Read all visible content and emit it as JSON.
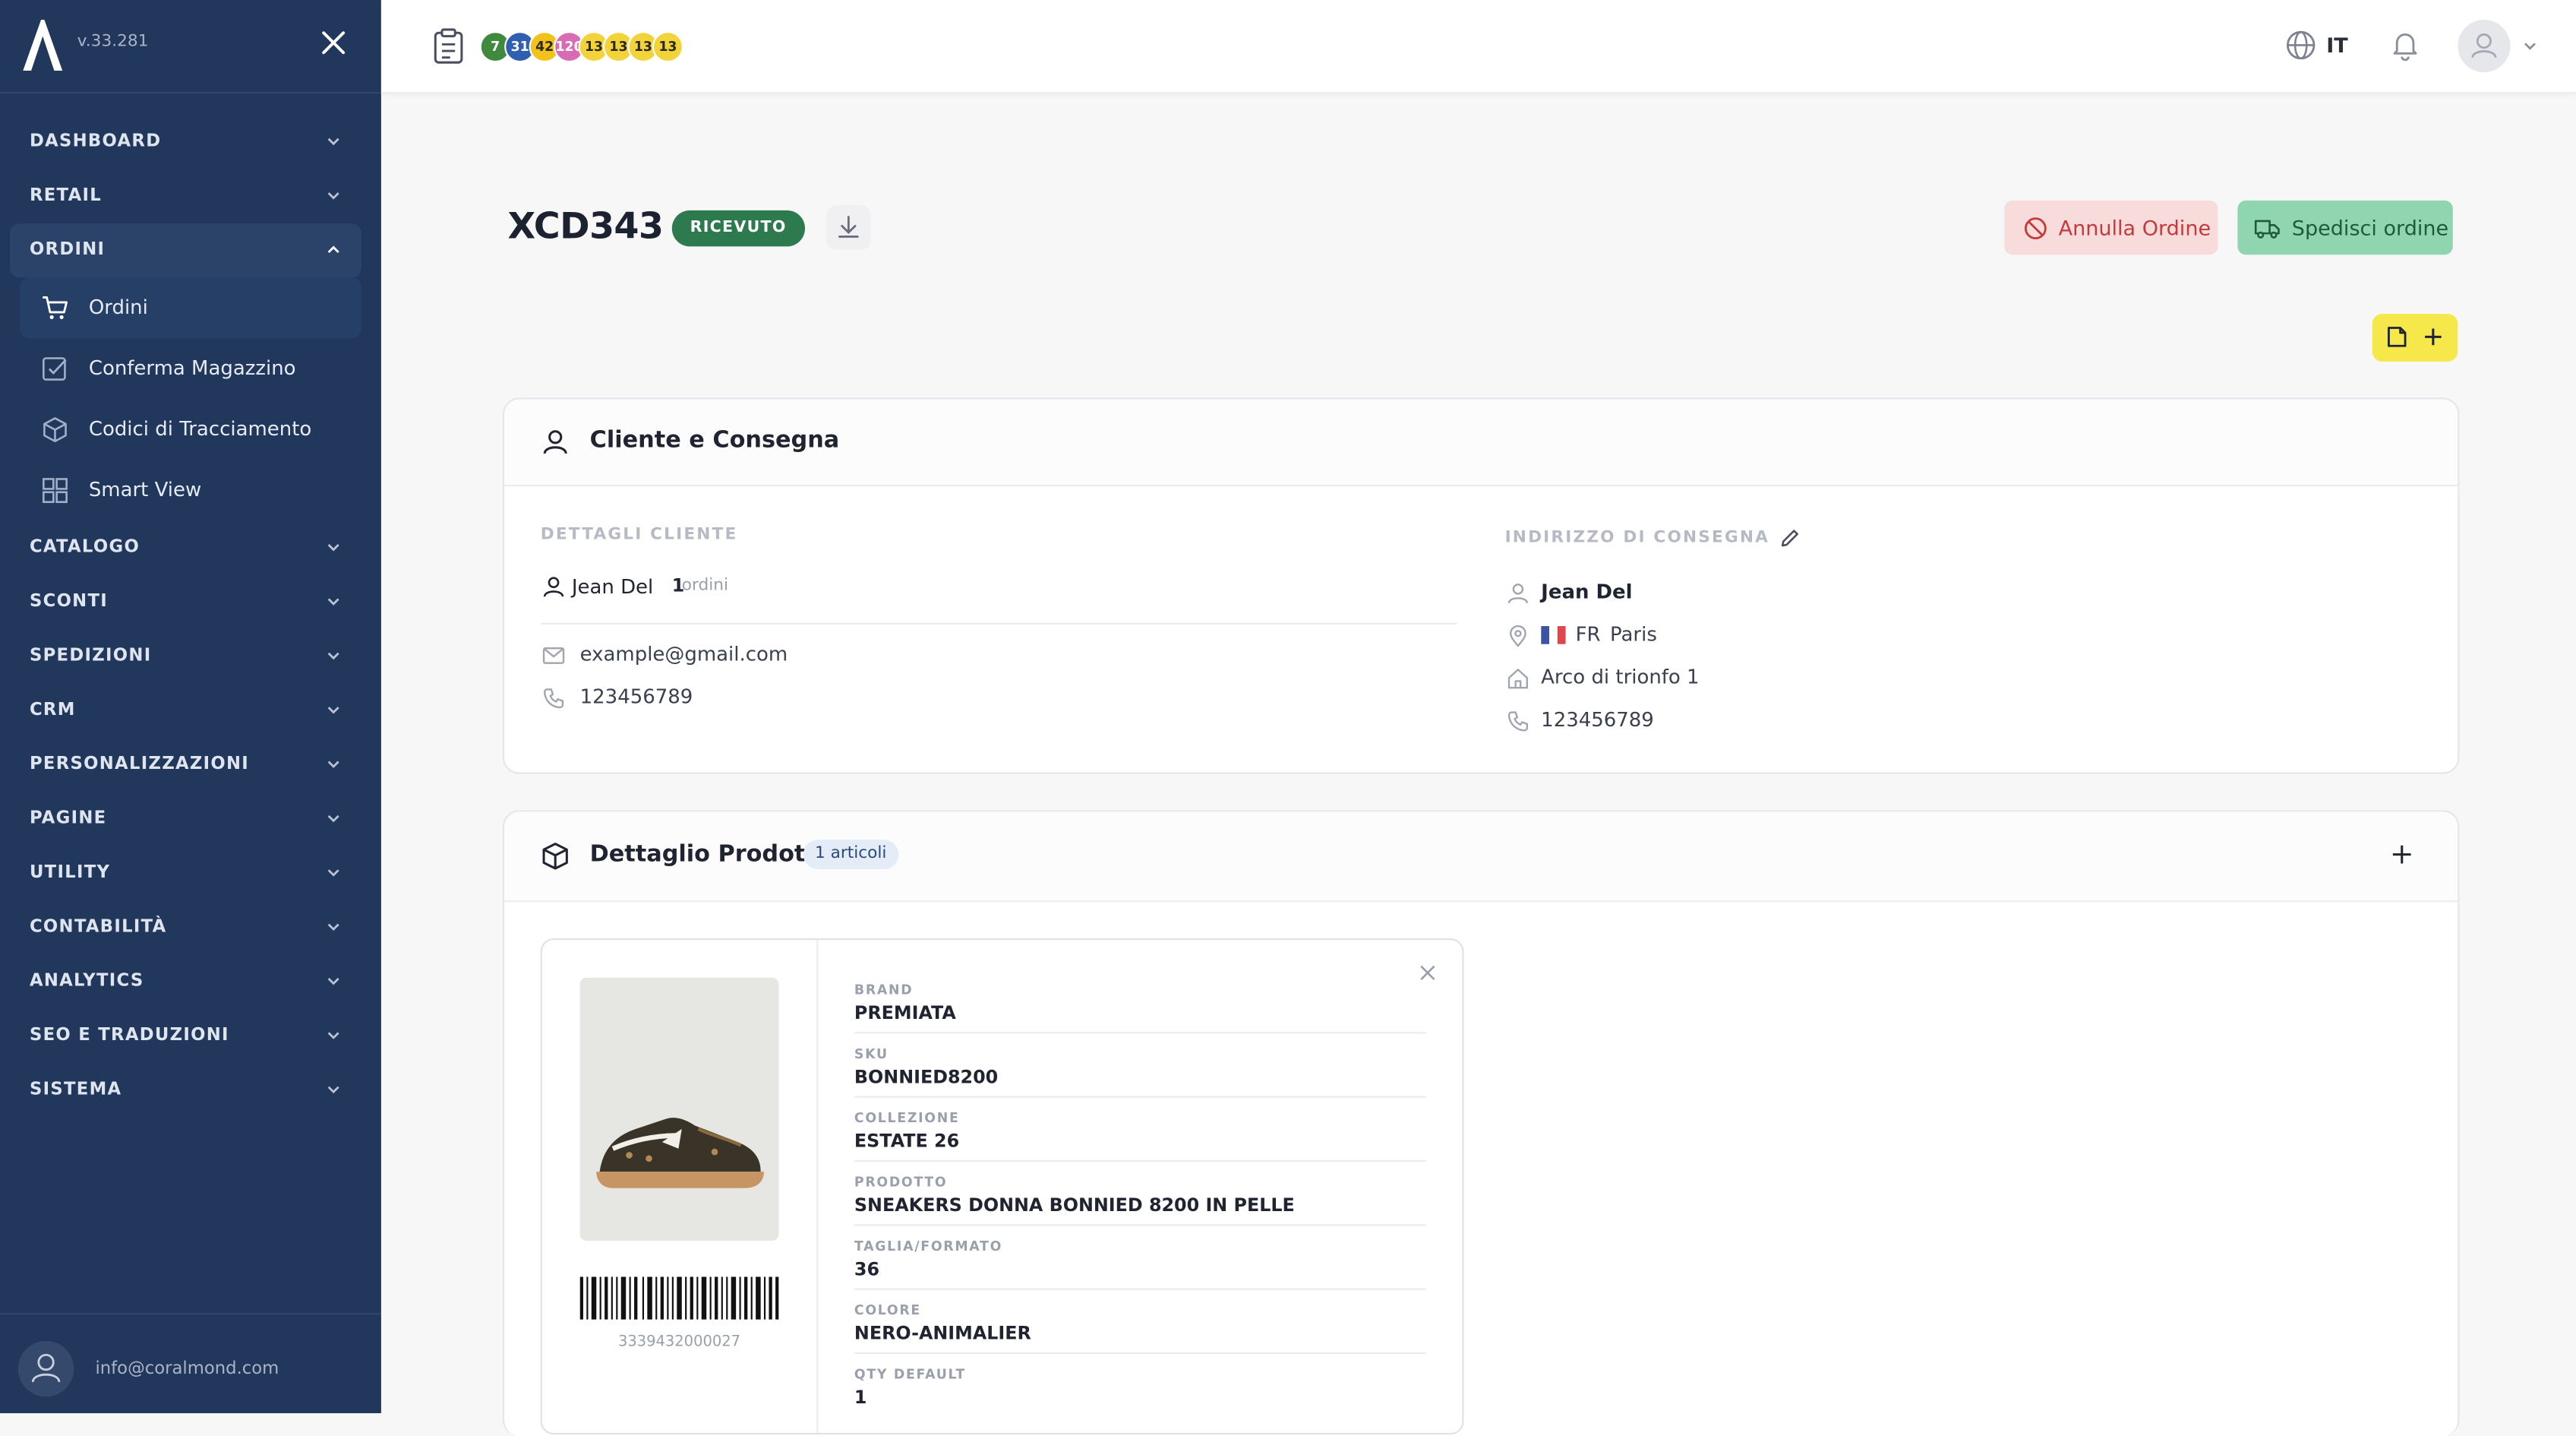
{
  "app": {
    "version": "v.33.281"
  },
  "sidebar": {
    "sections_top": [
      {
        "label": "DASHBOARD"
      },
      {
        "label": "RETAIL"
      }
    ],
    "active_section": {
      "label": "ORDINI"
    },
    "sub_items": [
      {
        "label": "Ordini",
        "icon": "cart-icon"
      },
      {
        "label": "Conferma Magazzino",
        "icon": "checkbox-icon"
      },
      {
        "label": "Codici di Tracciamento",
        "icon": "box-icon"
      },
      {
        "label": "Smart View",
        "icon": "grid-icon"
      }
    ],
    "sections_bottom": [
      {
        "label": "CATALOGO"
      },
      {
        "label": "SCONTI"
      },
      {
        "label": "SPEDIZIONI"
      },
      {
        "label": "CRM"
      },
      {
        "label": "PERSONALIZZAZIONI"
      },
      {
        "label": "PAGINE"
      },
      {
        "label": "UTILITY"
      },
      {
        "label": "CONTABILITÀ"
      },
      {
        "label": "ANALYTICS"
      },
      {
        "label": "SEO E TRADUZIONI"
      },
      {
        "label": "SISTEMA"
      }
    ],
    "footer_email": "info@coralmond.com"
  },
  "topbar": {
    "badges": [
      {
        "label": "7",
        "color": "#3f8a3f"
      },
      {
        "label": "31",
        "color": "#2f5fb0"
      },
      {
        "label": "42",
        "color": "#f2c21b"
      },
      {
        "label": "120",
        "color": "#d96bb4"
      },
      {
        "label": "13",
        "color": "#f2d43a"
      },
      {
        "label": "13",
        "color": "#f2d43a"
      },
      {
        "label": "13",
        "color": "#f2d43a"
      },
      {
        "label": "13",
        "color": "#f2d43a"
      }
    ],
    "language": "IT"
  },
  "order": {
    "code": "XCD343",
    "status": "RICEVUTO",
    "cancel_label": "Annulla Ordine",
    "ship_label": "Spedisci ordine"
  },
  "customer_card": {
    "title": "Cliente e Consegna",
    "details_label": "DETTAGLI CLIENTE",
    "customer_name": "Jean Del",
    "orders_count": "1",
    "orders_word": "ordini",
    "email": "example@gmail.com",
    "phone": "123456789",
    "delivery_label": "INDIRIZZO DI CONSEGNA",
    "delivery_name": "Jean Del",
    "delivery_country": "FR",
    "delivery_city": "Paris",
    "delivery_address": "Arco di trionfo 1",
    "delivery_phone": "123456789"
  },
  "products_card": {
    "title": "Dettaglio Prodotti",
    "count_badge": "1 articoli",
    "barcode_number": "3339432000027",
    "fields": [
      {
        "key": "BRAND",
        "value": "PREMIATA"
      },
      {
        "key": "SKU",
        "value": "BONNIED8200"
      },
      {
        "key": "COLLEZIONE",
        "value": "ESTATE 26"
      },
      {
        "key": "PRODOTTO",
        "value": "SNEAKERS DONNA BONNIED 8200 IN PELLE"
      },
      {
        "key": "TAGLIA/FORMATO",
        "value": "36"
      },
      {
        "key": "COLORE",
        "value": "NERO-ANIMALIER"
      },
      {
        "key": "QTY DEFAULT",
        "value": "1"
      }
    ]
  }
}
